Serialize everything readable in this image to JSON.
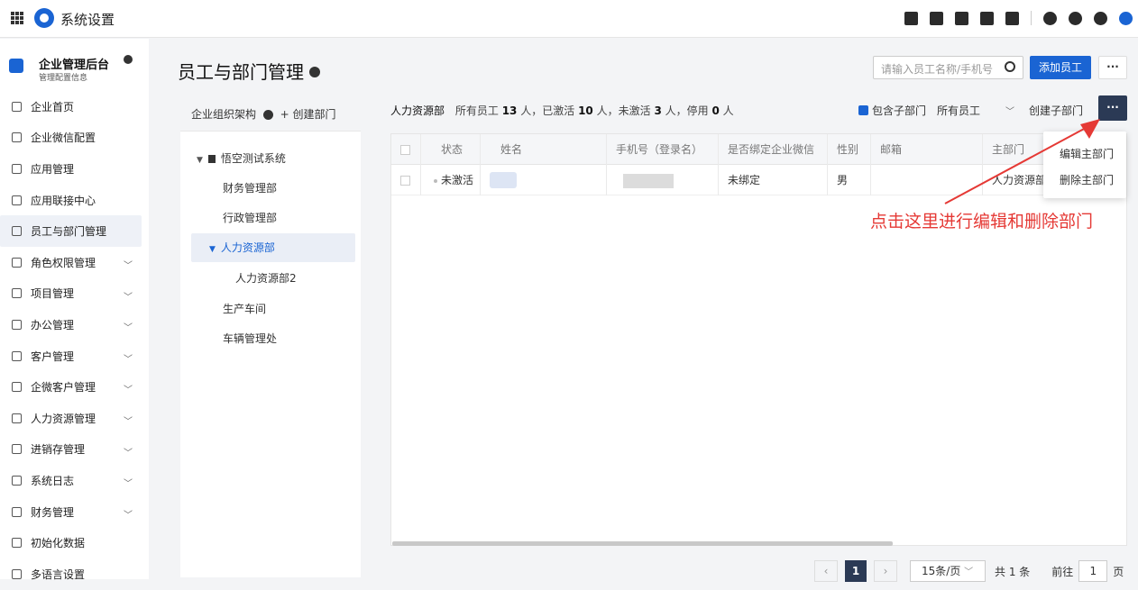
{
  "topbar": {
    "title": "系统设置",
    "icons": [
      "grid-icon",
      "logo-icon",
      "todo-icon",
      "contacts-icon",
      "doc-icon",
      "phone-icon",
      "calendar-icon",
      "bell-icon",
      "help-icon",
      "settings-icon",
      "avatar-icon"
    ]
  },
  "sidebar": {
    "brand_name": "企业管理后台",
    "brand_sub": "管理配置信息",
    "items": [
      {
        "label": "企业首页",
        "expand": false
      },
      {
        "label": "企业微信配置",
        "expand": false
      },
      {
        "label": "应用管理",
        "expand": false
      },
      {
        "label": "应用联接中心",
        "expand": false
      },
      {
        "label": "员工与部门管理",
        "expand": false,
        "active": true
      },
      {
        "label": "角色权限管理",
        "expand": true
      },
      {
        "label": "项目管理",
        "expand": true
      },
      {
        "label": "办公管理",
        "expand": true
      },
      {
        "label": "客户管理",
        "expand": true
      },
      {
        "label": "企微客户管理",
        "expand": true
      },
      {
        "label": "人力资源管理",
        "expand": true
      },
      {
        "label": "进销存管理",
        "expand": true
      },
      {
        "label": "系统日志",
        "expand": true
      },
      {
        "label": "财务管理",
        "expand": true
      },
      {
        "label": "初始化数据",
        "expand": false
      },
      {
        "label": "多语言设置",
        "expand": false
      }
    ],
    "chevron": "﹀"
  },
  "page": {
    "title": "员工与部门管理",
    "search_placeholder": "请输入员工名称/手机号",
    "add_button": "添加员工",
    "more": "···"
  },
  "tree": {
    "header": "企业组织架构",
    "create": "+ 创建部门",
    "root": "悟空测试系统",
    "nodes": [
      "财务管理部",
      "行政管理部",
      "人力资源部",
      "人力资源部2",
      "生产车间",
      "车辆管理处"
    ]
  },
  "summary": {
    "dept": "人力资源部",
    "p1": "所有员工",
    "total": "13",
    "p2": "人，已激活",
    "active": "10",
    "p3": "人，未激活",
    "inactive": "3",
    "p4": "人，停用",
    "disabled": "0",
    "p5": "人"
  },
  "options": {
    "include_sub": "包含子部门",
    "filter": "所有员工",
    "create_sub": "创建子部门"
  },
  "table": {
    "headers": [
      "状态",
      "姓名",
      "手机号（登录名）",
      "是否绑定企业微信",
      "性别",
      "邮箱",
      "主部门"
    ],
    "rows": [
      {
        "status": "未激活",
        "bind": "未绑定",
        "gender": "男",
        "dept": "人力资源部"
      }
    ]
  },
  "popup": {
    "edit": "编辑主部门",
    "delete": "删除主部门"
  },
  "annotation": "点击这里进行编辑和删除部门",
  "annotation_color": "#e53935",
  "pager": {
    "prev": "‹",
    "current": "1",
    "next": "›",
    "size": "15条/页",
    "total": "共 1 条",
    "goto": "前往",
    "goto_value": "1",
    "page_unit": "页"
  },
  "colors": {
    "accent": "#1a64d3",
    "dark": "#2b3a55"
  }
}
